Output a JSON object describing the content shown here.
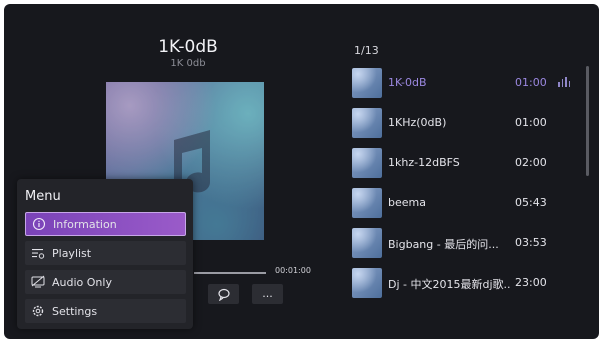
{
  "now_playing": {
    "title": "1K-0dB",
    "subtitle": "1K 0db",
    "total_time": "00:01:00"
  },
  "controls": [
    {
      "icon": "repeat-icon"
    },
    {
      "icon": "more-icon",
      "label": "..."
    }
  ],
  "menu": {
    "title": "Menu",
    "items": [
      {
        "label": "Information",
        "icon": "info-icon",
        "active": true
      },
      {
        "label": "Playlist",
        "icon": "playlist-icon"
      },
      {
        "label": "Audio Only",
        "icon": "audio-only-icon"
      },
      {
        "label": "Settings",
        "icon": "settings-icon"
      }
    ]
  },
  "playlist": {
    "count": "1/13",
    "items": [
      {
        "name": "1K-0dB",
        "duration": "01:00",
        "current": true
      },
      {
        "name": "1KHz(0dB)",
        "duration": "01:00"
      },
      {
        "name": "1khz-12dBFS",
        "duration": "02:00"
      },
      {
        "name": "beema",
        "duration": "05:43"
      },
      {
        "name": "Bigbang - 最后的问...",
        "duration": "03:53"
      },
      {
        "name": "Dj - 中文2015最新dj歌...",
        "duration": "23:00"
      }
    ]
  },
  "colors": {
    "background": "#17181d",
    "accent": "#9b88e0",
    "menu_active": "#8a4fc4"
  }
}
